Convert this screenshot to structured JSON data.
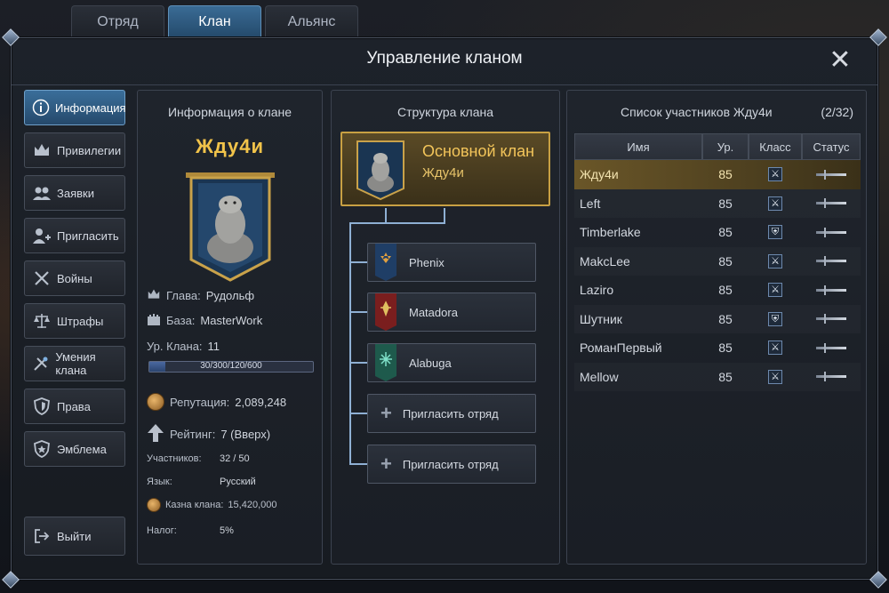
{
  "tabs": [
    {
      "label": "Отряд",
      "active": false
    },
    {
      "label": "Клан",
      "active": true
    },
    {
      "label": "Альянс",
      "active": false
    }
  ],
  "window": {
    "title": "Управление кланом",
    "close_icon": "close-icon"
  },
  "nav": {
    "items": [
      {
        "label": "Информация",
        "icon": "info-icon",
        "active": true
      },
      {
        "label": "Привилегии",
        "icon": "crown-icon"
      },
      {
        "label": "Заявки",
        "icon": "users-icon"
      },
      {
        "label": "Пригласить",
        "icon": "add-user-icon"
      },
      {
        "label": "Войны",
        "icon": "crossed-swords-icon"
      },
      {
        "label": "Штрафы",
        "icon": "scales-icon"
      },
      {
        "label": "Умения клана",
        "icon": "skills-icon"
      },
      {
        "label": "Права",
        "icon": "shield-icon"
      },
      {
        "label": "Эмблема",
        "icon": "emblem-icon"
      }
    ],
    "exit": {
      "label": "Выйти",
      "icon": "exit-icon"
    }
  },
  "info": {
    "title": "Информация о клане",
    "clan_name": "Жду4и",
    "leader_label": "Глава:",
    "leader": "Рудольф",
    "base_label": "База:",
    "base": "MasterWork",
    "level_label": "Ур. Клана:",
    "level": "11",
    "xp_text": "30/300/120/600",
    "xp_progress": 0.1,
    "reputation_label": "Репутация:",
    "reputation": "2,089,248",
    "rating_label": "Рейтинг:",
    "rating": "7 (Вверх)",
    "members_label": "Участников:",
    "members": "32 / 50",
    "language_label": "Язык:",
    "language": "Русский",
    "treasury_label": "Казна клана:",
    "treasury": "15,420,000",
    "tax_label": "Налог:",
    "tax": "5%"
  },
  "structure": {
    "title": "Структура клана",
    "main": {
      "title": "Основной клан",
      "name": "Жду4и"
    },
    "squads": [
      {
        "name": "Phenix",
        "flag_color": "#1f3e66",
        "emblem_color": "#e0a040"
      },
      {
        "name": "Matadora",
        "flag_color": "#7a1e1e",
        "emblem_color": "#e0c060"
      },
      {
        "name": "Alabuga",
        "flag_color": "#1e5a4c",
        "emblem_color": "#7fe0c8"
      }
    ],
    "invite_label": "Пригласить отряд"
  },
  "members": {
    "title": "Список участников Жду4и",
    "count": "(2/32)",
    "headers": {
      "name": "Имя",
      "level": "Ур.",
      "class": "Класс",
      "status": "Статус"
    },
    "rows": [
      {
        "name": "Жду4и",
        "level": "85",
        "class": "sword",
        "selected": true
      },
      {
        "name": "Left",
        "level": "85",
        "class": "sword"
      },
      {
        "name": "Timberlake",
        "level": "85",
        "class": "shield"
      },
      {
        "name": "MakcLee",
        "level": "85",
        "class": "sword"
      },
      {
        "name": "Laziro",
        "level": "85",
        "class": "sword"
      },
      {
        "name": "Шутник",
        "level": "85",
        "class": "shield"
      },
      {
        "name": "РоманПервый",
        "level": "85",
        "class": "sword"
      },
      {
        "name": "Mellow",
        "level": "85",
        "class": "sword"
      }
    ]
  }
}
